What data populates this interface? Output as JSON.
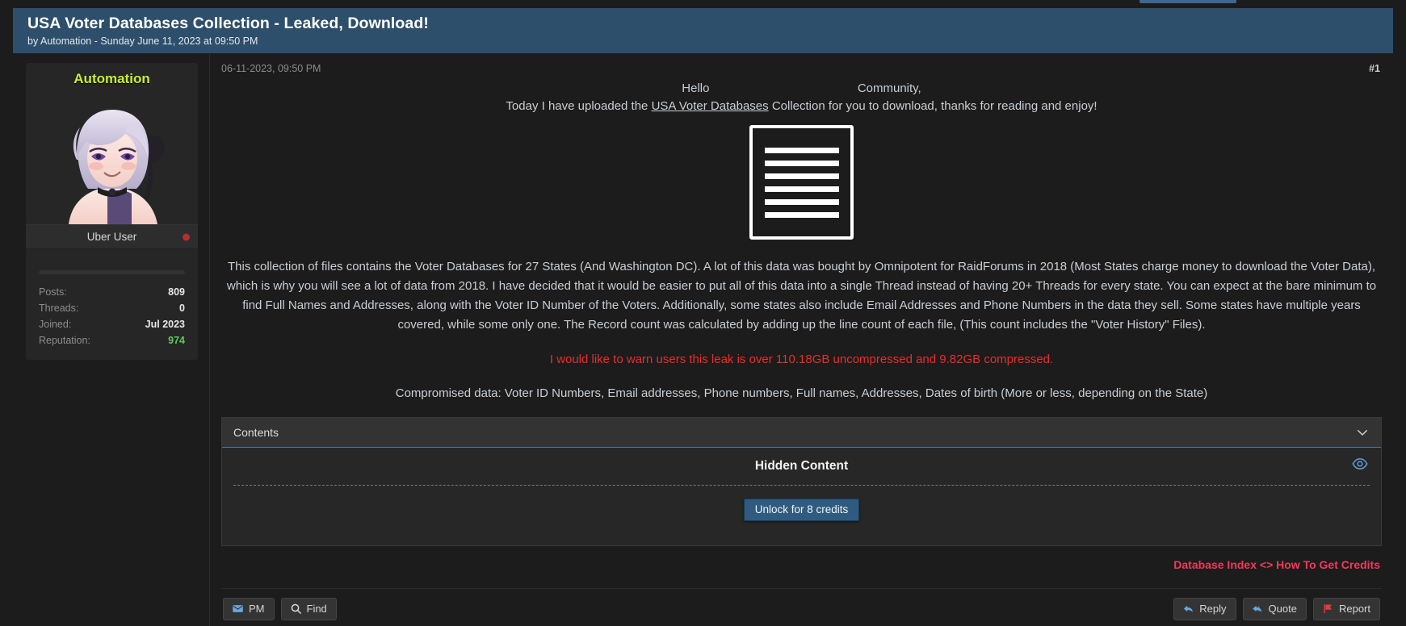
{
  "thread": {
    "title": "USA Voter Databases Collection - Leaked, Download!",
    "byline": "by Automation - Sunday June 11, 2023 at 09:50 PM"
  },
  "author": {
    "name": "Automation",
    "usertitle": "Uber User",
    "status": "offline",
    "stats": [
      {
        "key": "Posts:",
        "value": "809"
      },
      {
        "key": "Threads:",
        "value": "0"
      },
      {
        "key": "Joined:",
        "value": "Jul 2023"
      },
      {
        "key": "Reputation:",
        "value": "974"
      }
    ]
  },
  "post": {
    "date": "06-11-2023, 09:50 PM",
    "number": "#1",
    "greeting_hello": "Hello",
    "greeting_community": "Community,",
    "intro_before_link": "Today I have uploaded the ",
    "intro_link": "USA Voter Databases",
    "intro_after_link": " Collection for you to download, thanks for reading and enjoy!",
    "body": "This collection of files contains the Voter Databases for 27 States (And Washington DC). A lot of this data was bought by Omnipotent for RaidForums in 2018 (Most States charge money to download the Voter Data), which is why you will see a lot of data from 2018. I have decided that it would be easier to put all of this data into a single Thread instead of having 20+ Threads for every state. You can expect at the bare minimum to find Full Names and Addresses, along with the Voter ID Number of the Voters. Additionally, some states also include Email Addresses and Phone Numbers in the data they sell. Some states have multiple years covered, while some only one. The Record count was calculated by adding up the line count of each file, (This count includes the \"Voter History\" Files).",
    "warning": "I would like to warn users this leak is over 110.18GB uncompressed and 9.82GB compressed.",
    "compromised": "Compromised data: Voter ID Numbers, Email addresses, Phone numbers, Full names, Addresses, Dates of birth (More or less, depending on the State)"
  },
  "spoiler": {
    "header": "Contents",
    "hidden_title": "Hidden Content",
    "unlock_label": "Unlock for 8 credits"
  },
  "signature": {
    "link_left": "Database Index",
    "separator": "<>",
    "link_right": "How To Get Credits"
  },
  "controls": {
    "left": [
      {
        "label": "PM",
        "icon": "envelope-icon"
      },
      {
        "label": "Find",
        "icon": "search-icon"
      }
    ],
    "right": [
      {
        "label": "Reply",
        "icon": "reply-icon"
      },
      {
        "label": "Quote",
        "icon": "quote-icon"
      },
      {
        "label": "Report",
        "icon": "flag-icon"
      }
    ]
  },
  "colors": {
    "header_bg": "#2d4f6b",
    "username": "#c9f227",
    "warning": "#ee2b2b",
    "link_pink": "#ef3b5b",
    "reputation_positive": "#5ec85e",
    "unlock_button": "#2f5b80"
  }
}
